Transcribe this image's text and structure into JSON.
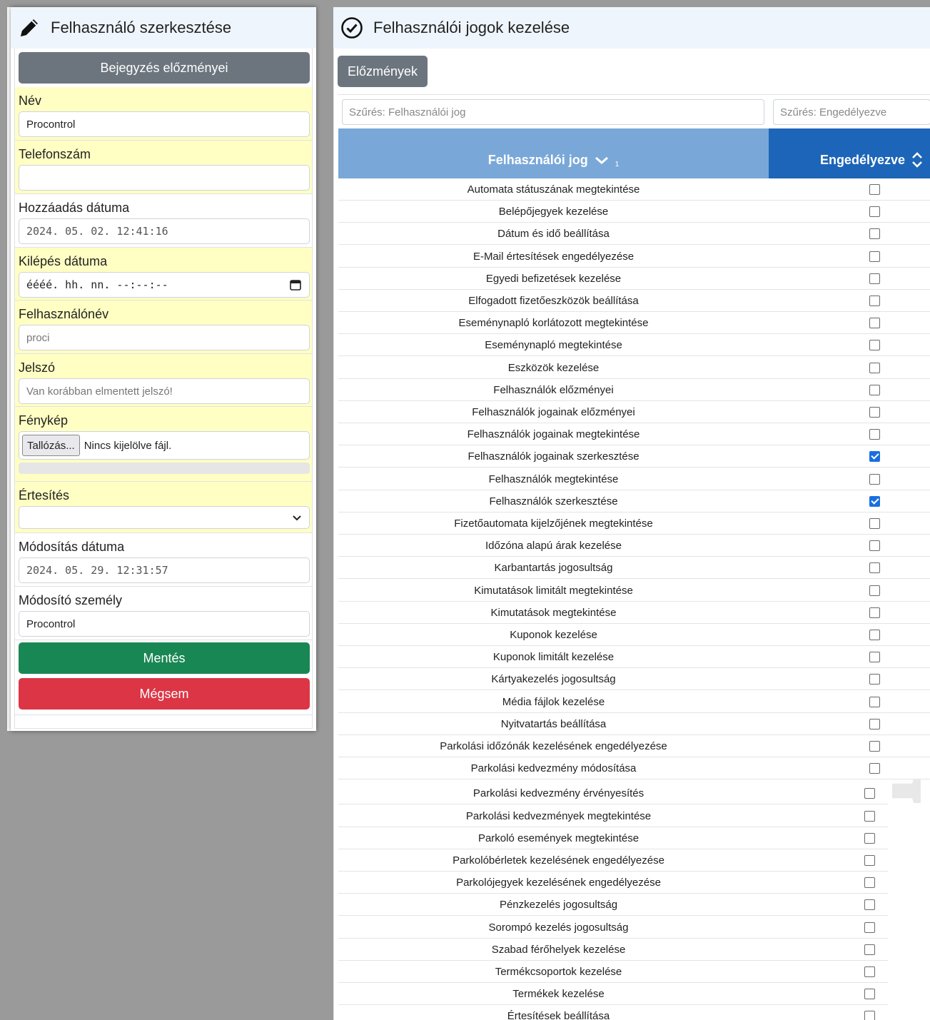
{
  "left": {
    "title": "Felhasználó szerkesztése",
    "history_button": "Bejegyzés előzményei",
    "fields": {
      "name": {
        "label": "Név",
        "value": "Procontrol"
      },
      "phone": {
        "label": "Telefonszám",
        "value": ""
      },
      "added": {
        "label": "Hozzáadás dátuma",
        "value": "2024. 05. 02. 12:41:16"
      },
      "exit": {
        "label": "Kilépés dátuma",
        "value": "éééé. hh. nn. --:--:--"
      },
      "username": {
        "label": "Felhasználónév",
        "value": "proci"
      },
      "password": {
        "label": "Jelszó",
        "placeholder": "Van korábban elmentett jelszó!"
      },
      "photo": {
        "label": "Fénykép",
        "browse": "Tallózás...",
        "status": "Nincs kijelölve fájl."
      },
      "notify": {
        "label": "Értesítés",
        "value": ""
      },
      "modified": {
        "label": "Módosítás dátuma",
        "value": "2024. 05. 29. 12:31:57"
      },
      "modifier": {
        "label": "Módosító személy",
        "value": "Procontrol"
      }
    },
    "save_button": "Mentés",
    "cancel_button": "Mégsem"
  },
  "right": {
    "title": "Felhasználói jogok kezelése",
    "history_button": "Előzmények",
    "filter_right": "Szűrés: Felhasználói jog",
    "filter_enabled": "Szűrés: Engedélyezve",
    "col_right": "Felhasználói jog",
    "col_enabled": "Engedélyezve",
    "sort_index": "1",
    "rows": [
      {
        "label": "Automata státuszának megtekintése",
        "enabled": false
      },
      {
        "label": "Belépőjegyek kezelése",
        "enabled": false
      },
      {
        "label": "Dátum és idő beállítása",
        "enabled": false
      },
      {
        "label": "E-Mail értesítések engedélyezése",
        "enabled": false
      },
      {
        "label": "Egyedi befizetések kezelése",
        "enabled": false
      },
      {
        "label": "Elfogadott fizetőeszközök beállítása",
        "enabled": false
      },
      {
        "label": "Eseménynapló korlátozott megtekintése",
        "enabled": false
      },
      {
        "label": "Eseménynapló megtekintése",
        "enabled": false
      },
      {
        "label": "Eszközök kezelése",
        "enabled": false
      },
      {
        "label": "Felhasználók előzményei",
        "enabled": false
      },
      {
        "label": "Felhasználók jogainak előzményei",
        "enabled": false
      },
      {
        "label": "Felhasználók jogainak megtekintése",
        "enabled": false
      },
      {
        "label": "Felhasználók jogainak szerkesztése",
        "enabled": true
      },
      {
        "label": "Felhasználók megtekintése",
        "enabled": false
      },
      {
        "label": "Felhasználók szerkesztése",
        "enabled": true
      },
      {
        "label": "Fizetőautomata kijelzőjének megtekintése",
        "enabled": false
      },
      {
        "label": "Időzóna alapú árak kezelése",
        "enabled": false
      },
      {
        "label": "Karbantartás jogosultság",
        "enabled": false
      },
      {
        "label": "Kimutatások limitált megtekintése",
        "enabled": false
      },
      {
        "label": "Kimutatások megtekintése",
        "enabled": false
      },
      {
        "label": "Kuponok kezelése",
        "enabled": false
      },
      {
        "label": "Kuponok limitált kezelése",
        "enabled": false
      },
      {
        "label": "Kártyakezelés jogosultság",
        "enabled": false
      },
      {
        "label": "Média fájlok kezelése",
        "enabled": false
      },
      {
        "label": "Nyitvatartás beállítása",
        "enabled": false
      },
      {
        "label": "Parkolási időzónák kezelésének engedélyezése",
        "enabled": false
      },
      {
        "label": "Parkolási kedvezmény módosítása",
        "enabled": false
      },
      {
        "label": "Parkolási kedvezmény érvényesítés",
        "enabled": false
      },
      {
        "label": "Parkolási kedvezmények megtekintése",
        "enabled": false
      },
      {
        "label": "Parkoló események megtekintése",
        "enabled": false
      },
      {
        "label": "Parkolóbérletek kezelésének engedélyezése",
        "enabled": false
      },
      {
        "label": "Parkolójegyek kezelésének engedélyezése",
        "enabled": false
      },
      {
        "label": "Pénzkezelés jogosultság",
        "enabled": false
      },
      {
        "label": "Sorompó kezelés jogosultság",
        "enabled": false
      },
      {
        "label": "Szabad férőhelyek kezelése",
        "enabled": false
      },
      {
        "label": "Termékcsoportok kezelése",
        "enabled": false
      },
      {
        "label": "Termékek kezelése",
        "enabled": false
      },
      {
        "label": "Értesítések beállítása",
        "enabled": false
      }
    ]
  }
}
